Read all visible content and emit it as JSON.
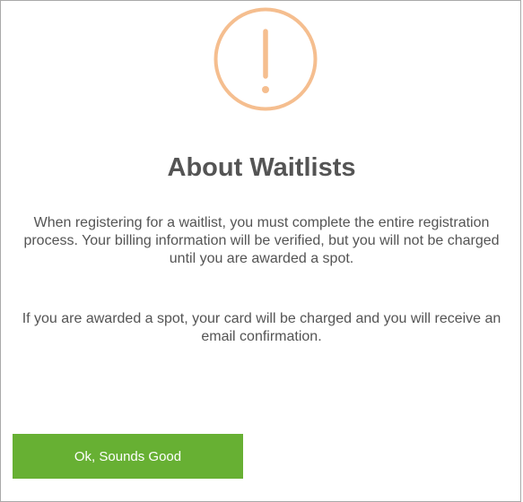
{
  "dialog": {
    "icon": "exclamation-circle-icon",
    "icon_color": "#f5be8f",
    "title": "About Waitlists",
    "paragraph_1": "When registering for a waitlist, you must complete the entire registration process. Your billing information will be verified, but you will not be charged until you are awarded a spot.",
    "paragraph_2": "If you are awarded a spot, your card will be charged and you will receive an email confirmation.",
    "confirm_label": "Ok, Sounds Good",
    "confirm_color": "#67b033"
  }
}
